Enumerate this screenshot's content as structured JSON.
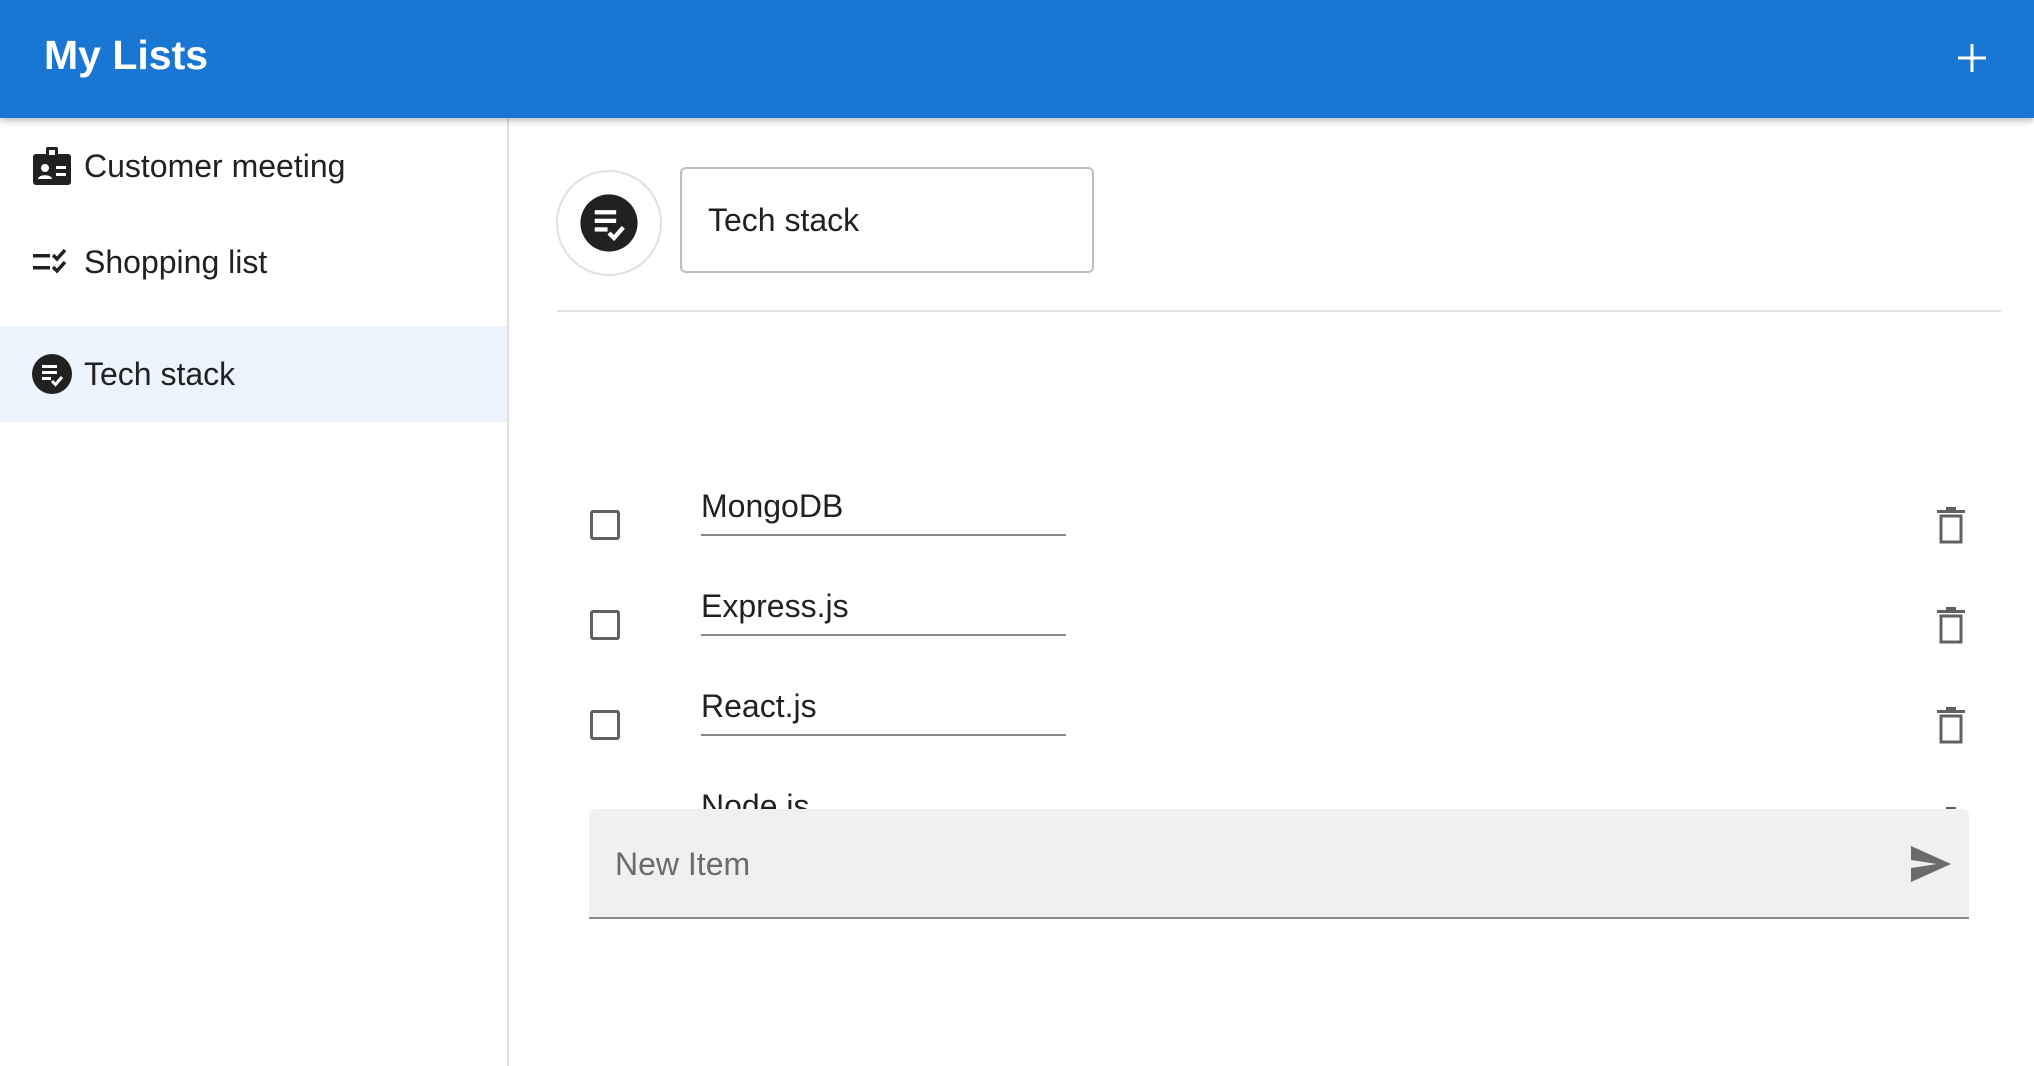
{
  "app": {
    "title": "My Lists",
    "add_icon": "plus-icon"
  },
  "sidebar": {
    "items": [
      {
        "label": "Customer meeting",
        "icon": "badge-icon",
        "selected": false
      },
      {
        "label": "Shopping list",
        "icon": "checklist-icon",
        "selected": false
      },
      {
        "label": "Tech stack",
        "icon": "list-check-circle-icon",
        "selected": true
      }
    ]
  },
  "main": {
    "list_icon": "list-check-circle-icon",
    "list_name": "Tech stack",
    "items": [
      {
        "text": "MongoDB",
        "checked": false
      },
      {
        "text": "Express.js",
        "checked": false
      },
      {
        "text": "React.js",
        "checked": false
      },
      {
        "text": "Node.js",
        "checked": false
      }
    ],
    "new_item": {
      "placeholder": "New Item",
      "value": "",
      "send_icon": "send-icon"
    }
  },
  "colors": {
    "appbar": "#1976d2",
    "selected_item": "#ebf3fc",
    "icon_dark": "#212121",
    "icon_grey": "#616161"
  }
}
